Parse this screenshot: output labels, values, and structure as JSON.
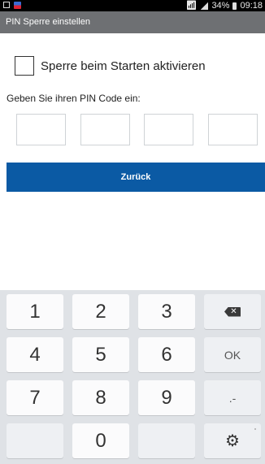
{
  "status_bar": {
    "signal": "ℝ",
    "battery_percent": "34%",
    "time": "09:18"
  },
  "title_bar": {
    "title": "PIN Sperre einstellen"
  },
  "checkbox": {
    "label": "Sperre beim Starten aktivieren",
    "checked": false
  },
  "pin": {
    "prompt": "Geben Sie ihren PIN Code ein:",
    "digits": [
      "",
      "",
      "",
      ""
    ]
  },
  "back_button": {
    "label": "Zurück"
  },
  "keyboard": {
    "rows": [
      [
        "1",
        "2",
        "3",
        "backspace-icon"
      ],
      [
        "4",
        "5",
        "6",
        "OK"
      ],
      [
        "7",
        "8",
        "9",
        ".-"
      ],
      [
        "",
        "0",
        "",
        "gear-icon"
      ]
    ],
    "k1": "1",
    "k2": "2",
    "k3": "3",
    "k4": "4",
    "k5": "5",
    "k6": "6",
    "ok": "OK",
    "k7": "7",
    "k8": "8",
    "k9": "9",
    "dotdash": ".-",
    "k0": "0"
  }
}
